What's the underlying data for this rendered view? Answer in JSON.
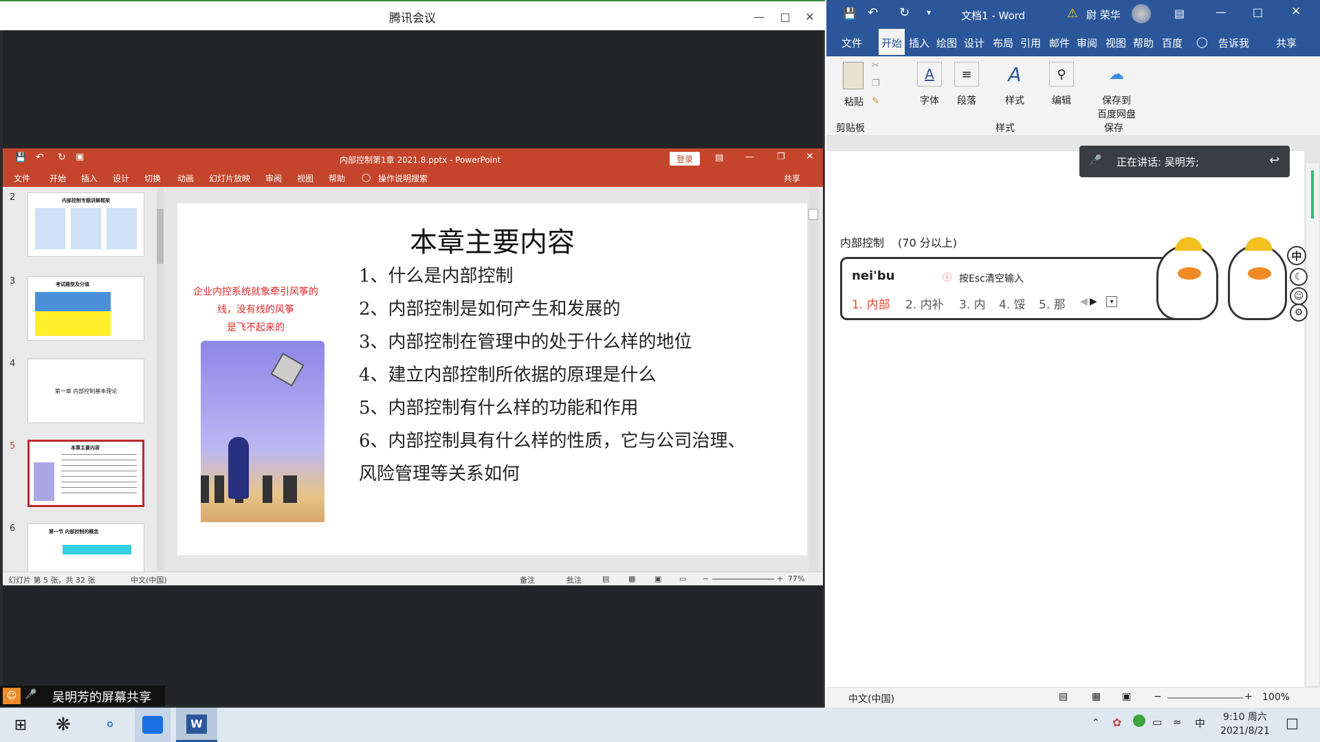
{
  "meeting": {
    "window_title": "腾讯会议",
    "share_label": "吴明芳的屏幕共享",
    "min_icon": "minimize-icon",
    "max_icon": "maximize-icon",
    "close_icon": "close-icon"
  },
  "ppt": {
    "title": "内部控制第1章 2021.8.pptx - PowerPoint",
    "login_label": "登录",
    "share_label": "共享",
    "tabs": [
      "文件",
      "开始",
      "插入",
      "设计",
      "切换",
      "动画",
      "幻灯片放映",
      "审阅",
      "视图",
      "帮助",
      "操作说明搜索"
    ],
    "thumbnails": [
      {
        "num": "2",
        "title": "内部控制专题讲解框架"
      },
      {
        "num": "3",
        "title": "考试题型及分值"
      },
      {
        "num": "4",
        "title": "第一章 内部控制基本理论"
      },
      {
        "num": "5",
        "title": "本章主要内容"
      },
      {
        "num": "6",
        "title": "第一节 内部控制的概念"
      }
    ],
    "slide": {
      "title": "本章主要内容",
      "side_caption_line1": "企业内控系统就象牵引风筝的线，没有线的风筝",
      "side_caption_line2": "是飞不起来的",
      "items": [
        "1、什么是内部控制",
        "2、内部控制是如何产生和发展的",
        "3、内部控制在管理中的处于什么样的地位",
        "4、建立内部控制所依据的原理是什么",
        "5、内部控制有什么样的功能和作用",
        "6、内部控制具有什么样的性质，它与公司治理、",
        "风险管理等关系如何"
      ]
    },
    "status": {
      "slide_info": "幻灯片 第 5 张，共 32 张",
      "language": "中文(中国)",
      "notes": "备注",
      "comments": "批注",
      "zoom": "77%"
    }
  },
  "word": {
    "title": "文档1 - Word",
    "user": "尉 荣华",
    "tabs": [
      "文件",
      "开始",
      "插入",
      "绘图",
      "设计",
      "布局",
      "引用",
      "邮件",
      "审阅",
      "视图",
      "帮助",
      "百度",
      "告诉我",
      "共享"
    ],
    "ribbon": {
      "paste": "粘贴",
      "clipboard": "剪贴板",
      "font": "字体",
      "paragraph": "段落",
      "styles": "样式",
      "styles_group": "样式",
      "edit": "编辑",
      "save_baidu": "保存到",
      "save_baidu2": "百度网盘",
      "save_group": "保存"
    },
    "speaking": "正在讲话: 吴明芳;",
    "doc_text_1": "内部控制",
    "doc_text_2": "(70 分以上)",
    "ime": {
      "input": "nei'bu",
      "hint": "按Esc清空输入",
      "candidates": [
        "1. 内部",
        "2. 内补",
        "3. 内",
        "4. 馁",
        "5. 那"
      ],
      "mode": "中"
    },
    "status": {
      "language": "中文(中国)",
      "zoom": "100%"
    }
  },
  "taskbar": {
    "ime_mode": "中",
    "time": "9:10 周六",
    "date": "2021/8/21"
  }
}
